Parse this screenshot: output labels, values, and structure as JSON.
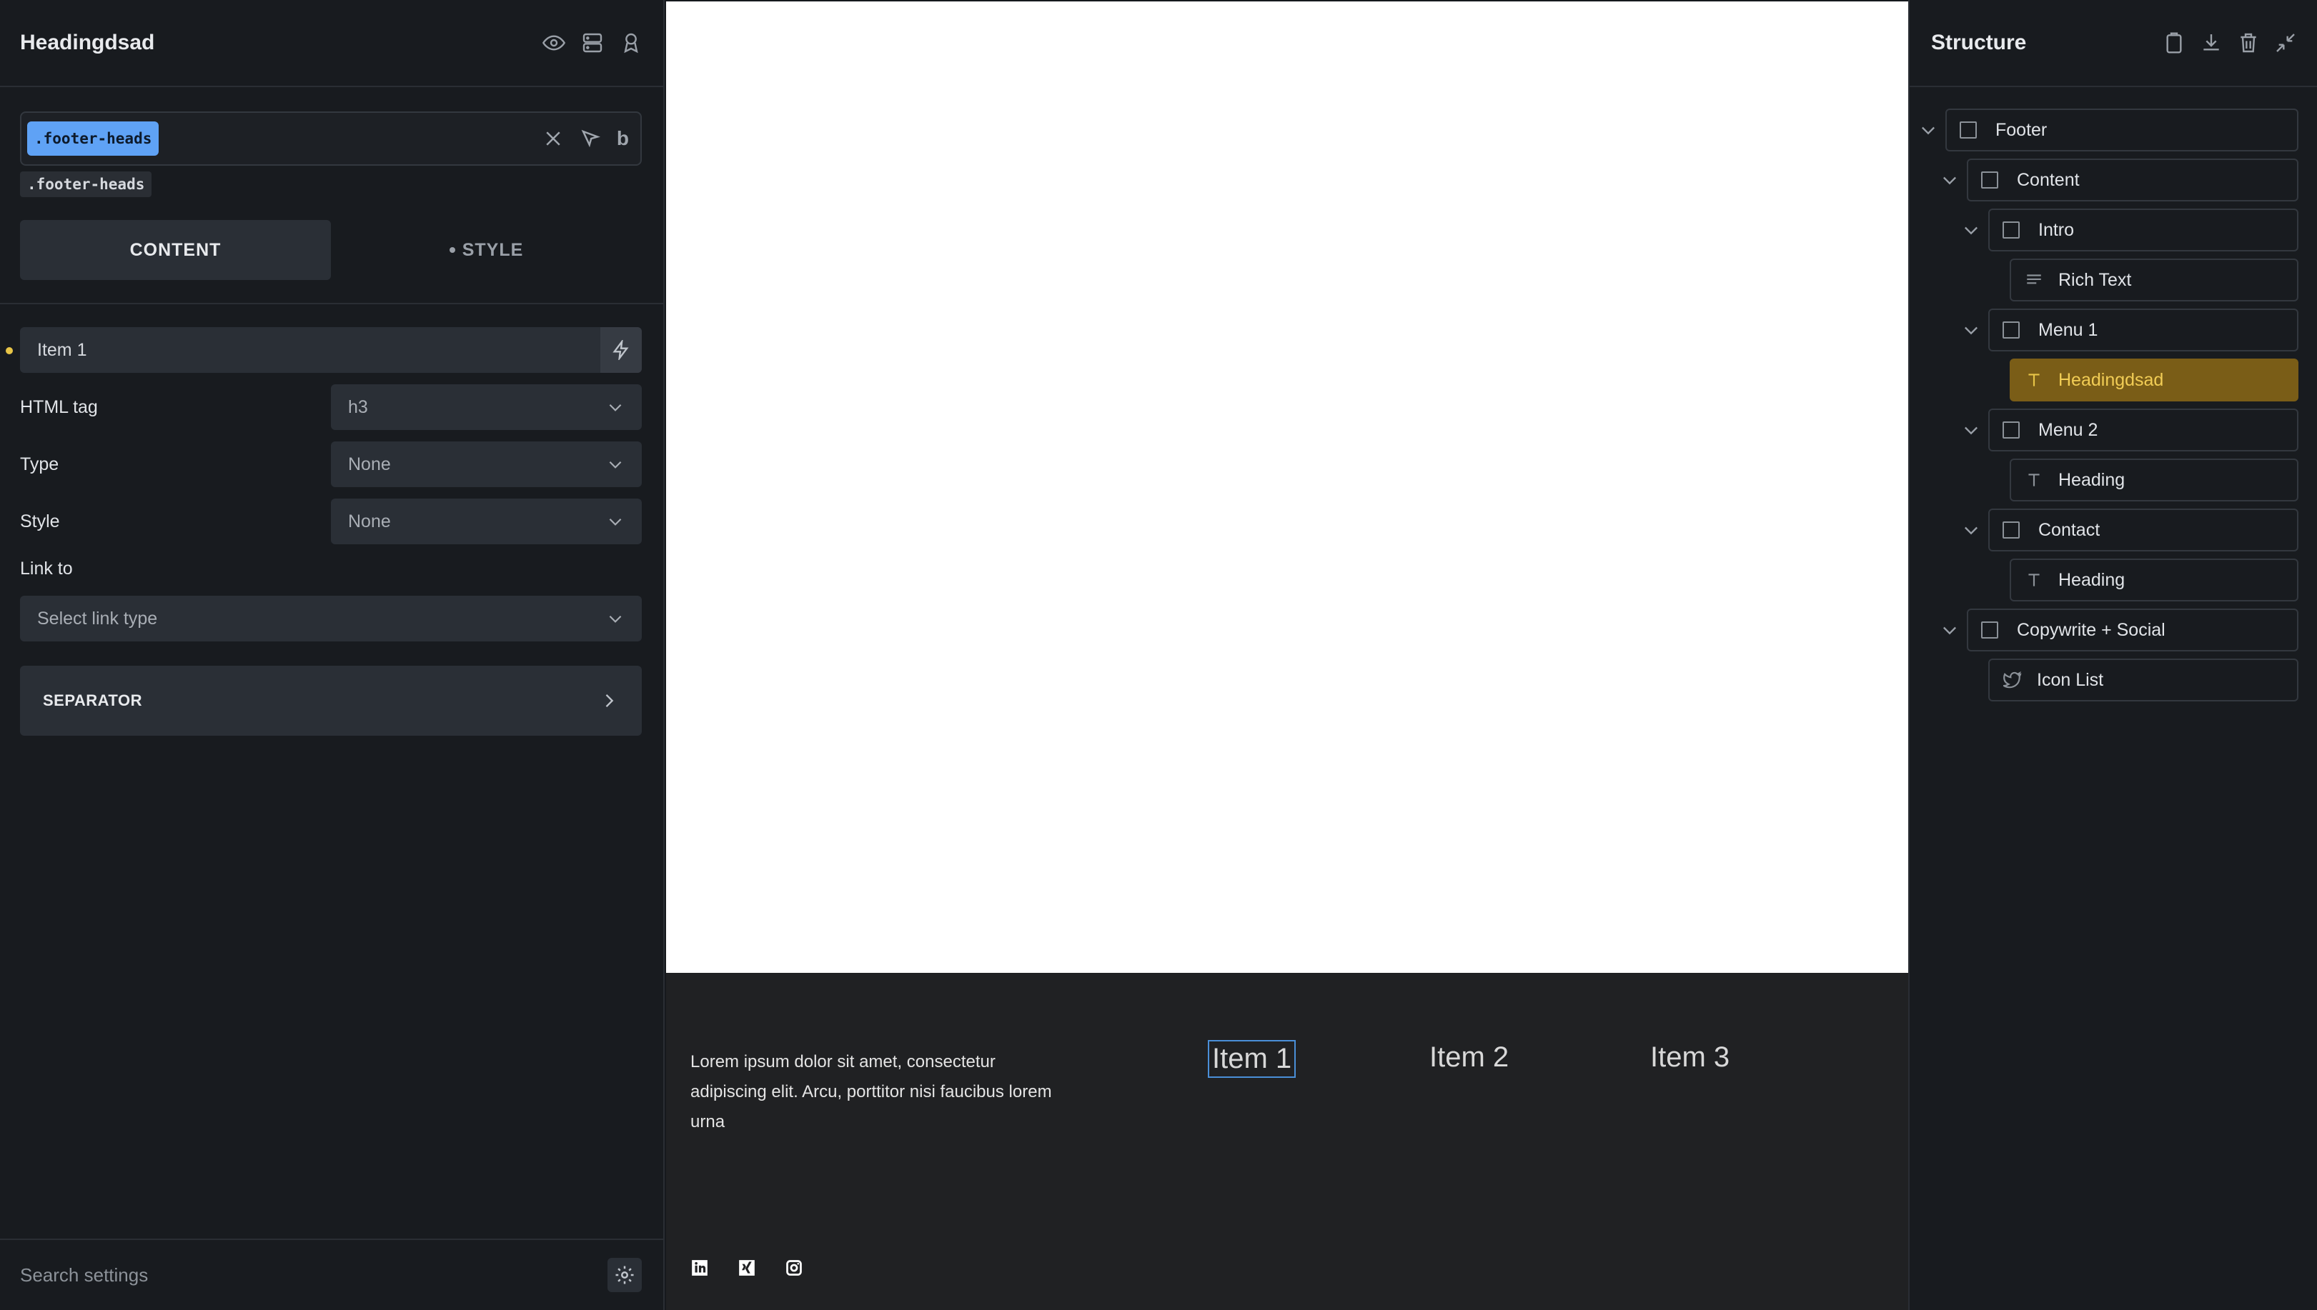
{
  "left_panel": {
    "title": "Headingdsad",
    "selector_chip": ".footer-heads",
    "class_tag": ".footer-heads",
    "bold_label": "b",
    "tabs": [
      {
        "label": "CONTENT",
        "active": true
      },
      {
        "label": "STYLE",
        "active": false
      }
    ],
    "text_field_value": "Item 1",
    "html_tag": {
      "label": "HTML tag",
      "value": "h3"
    },
    "type": {
      "label": "Type",
      "value": "None"
    },
    "style": {
      "label": "Style",
      "value": "None"
    },
    "link_to": {
      "label": "Link to",
      "placeholder": "Select link type"
    },
    "separator_label": "SEPARATOR",
    "search_placeholder": "Search settings"
  },
  "structure_panel": {
    "title": "Structure",
    "nodes": [
      {
        "label": "Footer",
        "icon": "box-icon"
      },
      {
        "label": "Content",
        "icon": "box-icon"
      },
      {
        "label": "Intro",
        "icon": "box-icon"
      },
      {
        "label": "Rich Text",
        "icon": "text-lines-icon"
      },
      {
        "label": "Menu 1",
        "icon": "box-icon"
      },
      {
        "label": "Headingdsad",
        "icon": "heading-t-icon",
        "selected": true
      },
      {
        "label": "Menu 2",
        "icon": "box-icon"
      },
      {
        "label": "Heading",
        "icon": "heading-t-icon"
      },
      {
        "label": "Contact",
        "icon": "box-icon"
      },
      {
        "label": "Heading",
        "icon": "heading-t-icon"
      },
      {
        "label": "Copywrite + Social",
        "icon": "box-icon"
      },
      {
        "label": "Icon List",
        "icon": "twitter-icon"
      }
    ]
  },
  "preview": {
    "intro_text": "Lorem ipsum dolor sit amet, consectetur adipiscing elit. Arcu, porttitor nisi faucibus lorem urna",
    "menu_items": [
      "Item 1",
      "Item 2",
      "Item 3"
    ],
    "social_icons": [
      "linkedin-icon",
      "xing-icon",
      "instagram-icon"
    ]
  },
  "colors": {
    "accent_blue": "#5fa2f5",
    "selected_node_bg": "#7a5d17",
    "selected_node_text": "#f2cd55"
  }
}
